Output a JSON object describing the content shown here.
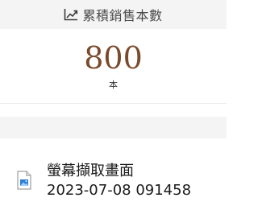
{
  "stats": {
    "title": "累積銷售本數",
    "value": "800",
    "unit": "本",
    "icon": "trending-up-icon",
    "value_color": "#7a4a2c"
  },
  "file": {
    "name_line1": "螢幕擷取畫面",
    "name_line2": "2023-07-08 091458",
    "icon": "image-file-icon"
  }
}
